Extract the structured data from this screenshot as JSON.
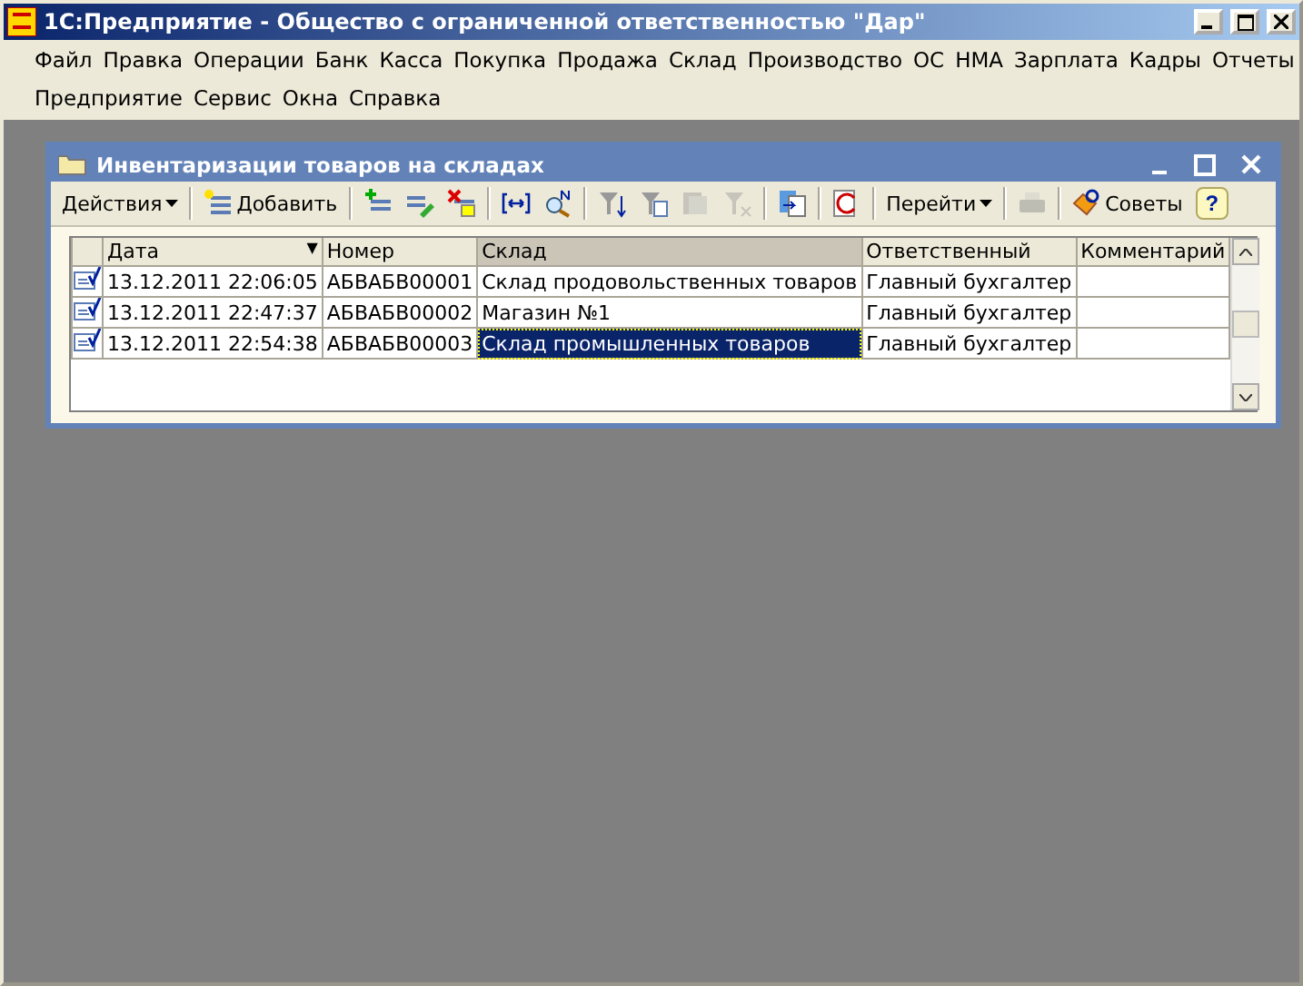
{
  "window": {
    "title": "1С:Предприятие - Общество с ограниченной ответственностью \"Дар\""
  },
  "menu": [
    [
      "Файл",
      "Правка",
      "Операции",
      "Банк",
      "Касса",
      "Покупка",
      "Продажа",
      "Склад",
      "Производство",
      "ОС",
      "НМА",
      "Зарплата",
      "Кадры",
      "Отчеты"
    ],
    [
      "Предприятие",
      "Сервис",
      "Окна",
      "Справка"
    ]
  ],
  "form": {
    "title": "Инвентаризации товаров на складах",
    "toolbar": [
      {
        "kind": "menu",
        "label": "Действия"
      },
      {
        "kind": "separator"
      },
      {
        "kind": "button",
        "label": "Добавить"
      },
      {
        "kind": "separator"
      },
      {
        "kind": "icon",
        "disabled": false
      },
      {
        "kind": "icon",
        "disabled": false
      },
      {
        "kind": "icon",
        "disabled": false
      },
      {
        "kind": "separator"
      },
      {
        "kind": "icon",
        "disabled": false
      },
      {
        "kind": "icon",
        "disabled": false
      },
      {
        "kind": "separator"
      },
      {
        "kind": "icon",
        "disabled": false
      },
      {
        "kind": "icon",
        "disabled": false
      },
      {
        "kind": "icon",
        "disabled": true
      },
      {
        "kind": "icon",
        "disabled": true
      },
      {
        "kind": "separator"
      },
      {
        "kind": "icon",
        "disabled": false
      },
      {
        "kind": "separator"
      },
      {
        "kind": "icon",
        "disabled": false
      },
      {
        "kind": "separator"
      },
      {
        "kind": "menu",
        "label": "Перейти"
      },
      {
        "kind": "separator"
      },
      {
        "kind": "icon",
        "disabled": true
      },
      {
        "kind": "separator"
      },
      {
        "kind": "button",
        "label": "Советы"
      },
      {
        "kind": "help",
        "label": "?"
      }
    ],
    "table": {
      "columns": [
        {
          "label": "Дата",
          "sort_mark": "▼",
          "selected": false
        },
        {
          "label": "Номер",
          "selected": false
        },
        {
          "label": "Склад",
          "selected": true
        },
        {
          "label": "Ответственный",
          "selected": false
        },
        {
          "label": "Комментарий",
          "selected": false
        }
      ],
      "rows": [
        {
          "cells": [
            "13.12.2011 22:06:05",
            "АБВАБВ00001",
            "Склад продовольственных товаров",
            "Главный бухгалтер",
            ""
          ],
          "selected": false
        },
        {
          "cells": [
            "13.12.2011 22:47:37",
            "АБВАБВ00002",
            "Магазин №1",
            "Главный бухгалтер",
            ""
          ],
          "selected": false
        },
        {
          "cells": [
            "13.12.2011 22:54:38",
            "АБВАБВ00003",
            "Склад промышленных товаров",
            "Главный бухгалтер",
            ""
          ],
          "selected": true
        }
      ]
    }
  }
}
